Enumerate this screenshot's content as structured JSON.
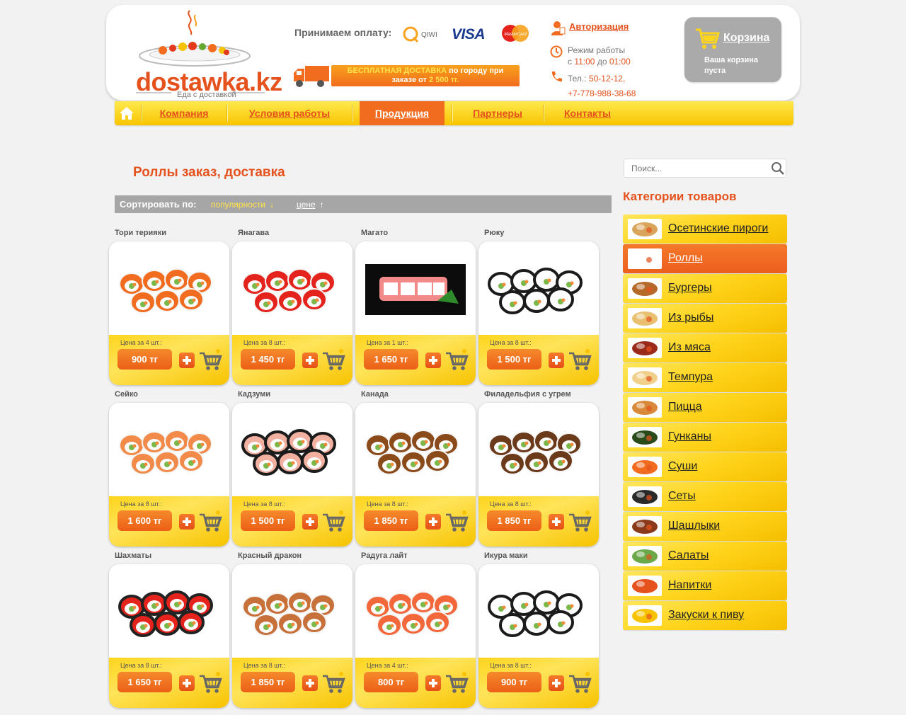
{
  "header": {
    "logo_text": "dostawka.kz",
    "logo_sub": "Еда с доставкой",
    "payment_label": "Принимаем оплату:",
    "payment_qiwi": "QIWI",
    "payment_visa": "VISA",
    "payment_mastercard": "MasterCard",
    "free_delivery_title": "БЕСПЛАТНАЯ ДОСТАВКА",
    "free_delivery_mid": " по городу при",
    "free_delivery_line2a": "заказе от ",
    "free_delivery_amount": "2 500 тг.",
    "auth_label": "Авторизация",
    "hours_title": "Режим работы",
    "hours_from_label": "с ",
    "hours_from": "11:00",
    "hours_to_label": " до ",
    "hours_to": "01:00",
    "phone_label": "Тел.: ",
    "phone_1": "50-12-12,",
    "phone_2": "+7-778-988-38-68",
    "cart_title": "Корзина",
    "cart_empty": "Ваша корзина пуста"
  },
  "nav": {
    "items": [
      "Компания",
      "Условия работы",
      "Продукция",
      "Партнеры",
      "Контакты"
    ],
    "active": "Продукция"
  },
  "main": {
    "page_title": "Роллы заказ, доставка",
    "sort_label": "Сортировать по:",
    "sort_options": [
      {
        "label": "популярности",
        "arrow": "↓"
      },
      {
        "label": "цене",
        "arrow": "↑"
      }
    ]
  },
  "products": [
    {
      "name": "Тори терияки",
      "price_for": "Цена за 4 шт.:",
      "price": "900 тг"
    },
    {
      "name": "Янагава",
      "price_for": "Цена за 8 шт.:",
      "price": "1 450 тг"
    },
    {
      "name": "Магато",
      "price_for": "Цена за 1 шт.:",
      "price": "1 650 тг"
    },
    {
      "name": "Рюку",
      "price_for": "Цена за 8 шт.:",
      "price": "1 500 тг"
    },
    {
      "name": "Сейко",
      "price_for": "Цена за 8 шт.:",
      "price": "1 600 тг"
    },
    {
      "name": "Кадзуми",
      "price_for": "Цена за 8 шт.:",
      "price": "1 500 тг"
    },
    {
      "name": "Канада",
      "price_for": "Цена за 8 шт.:",
      "price": "1 850 тг"
    },
    {
      "name": "Филадельфия с угрем",
      "price_for": "Цена за 8 шт.:",
      "price": "1 850 тг"
    },
    {
      "name": "Шахматы",
      "price_for": "Цена за 8 шт.:",
      "price": "1 650 тг"
    },
    {
      "name": "Красный дракон",
      "price_for": "Цена за 8 шт.:",
      "price": "1 850 тг"
    },
    {
      "name": "Радуга лайт",
      "price_for": "Цена за 4 шт.:",
      "price": "800 тг"
    },
    {
      "name": "Икура маки",
      "price_for": "Цена за 8 шт.:",
      "price": "900 тг"
    }
  ],
  "sidebar": {
    "search_placeholder": "Поиск...",
    "categories_title": "Категории товаров",
    "categories": [
      "Осетинские пироги",
      "Роллы",
      "Бургеры",
      "Из рыбы",
      "Из мяса",
      "Темпура",
      "Пицца",
      "Гунканы",
      "Суши",
      "Сеты",
      "Шашлыки",
      "Салаты",
      "Напитки",
      "Закуски к пиву"
    ],
    "active_category": "Роллы"
  },
  "colors": {
    "accent": "#e5521d",
    "orange": "#f26c1f",
    "yellow": "#ffd41c",
    "gray": "#a6a6a6"
  }
}
